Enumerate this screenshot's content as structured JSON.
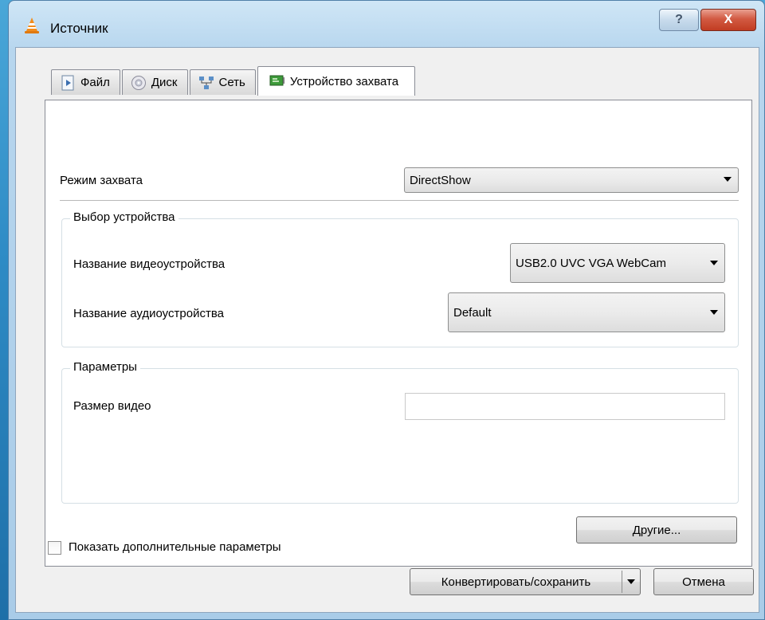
{
  "window": {
    "title": "Источник",
    "help_label": "?",
    "close_label": "X"
  },
  "tabs": [
    {
      "label": "Файл",
      "icon": "file-play-icon"
    },
    {
      "label": "Диск",
      "icon": "disc-icon"
    },
    {
      "label": "Сеть",
      "icon": "network-icon"
    },
    {
      "label": "Устройство захвата",
      "icon": "capture-card-icon",
      "active": true
    }
  ],
  "capture": {
    "mode_label": "Режим захвата",
    "mode_value": "DirectShow",
    "device_group": {
      "legend": "Выбор устройства",
      "video_label": "Название видеоустройства",
      "video_value": "USB2.0 UVC VGA WebCam",
      "audio_label": "Название аудиоустройства",
      "audio_value": "Default"
    },
    "params_group": {
      "legend": "Параметры",
      "video_size_label": "Размер видео",
      "video_size_value": ""
    },
    "other_button": "Другие..."
  },
  "footer": {
    "show_more_label": "Показать дополнительные параметры",
    "show_more_checked": false,
    "convert_button": "Конвертировать/сохранить",
    "cancel_button": "Отмена"
  },
  "colors": {
    "close_accent": "#c13c22",
    "desktop_bg": "#2f8cc6",
    "window_frame": "#b7d6ee"
  }
}
